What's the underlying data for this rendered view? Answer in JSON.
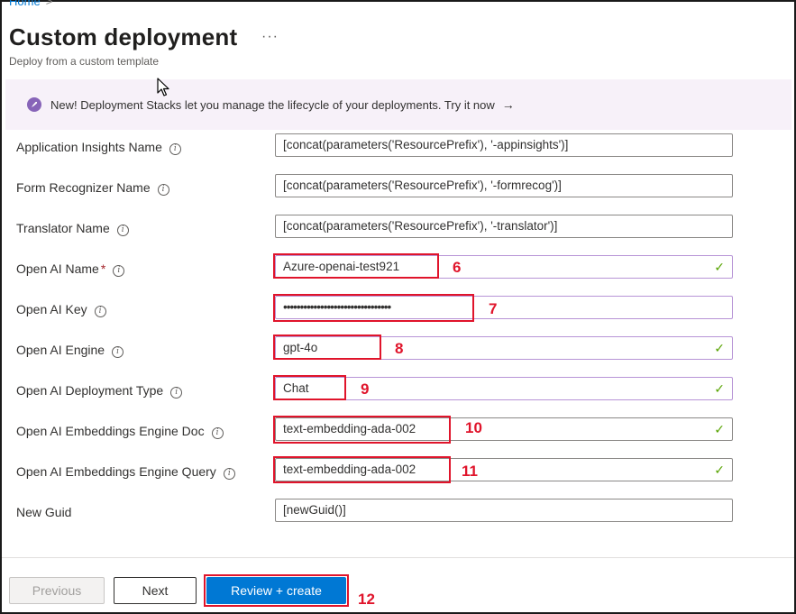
{
  "breadcrumb": {
    "home": "Home",
    "separator": ">"
  },
  "header": {
    "title": "Custom deployment",
    "more": "···",
    "subtitle": "Deploy from a custom template"
  },
  "banner": {
    "text": "New! Deployment Stacks let you manage the lifecycle of your deployments. Try it now",
    "arrow": "→",
    "icon": "rocket-badge-icon",
    "accent": "#8764b8"
  },
  "form": {
    "fields": [
      {
        "label": "Application Insights Name",
        "value": "[concat(parameters('ResourcePrefix'), '-appinsights')]"
      },
      {
        "label": "Form Recognizer Name",
        "value": "[concat(parameters('ResourcePrefix'), '-formrecog')]"
      },
      {
        "label": "Translator Name",
        "value": "[concat(parameters('ResourcePrefix'), '-translator')]"
      },
      {
        "label": "Open AI Name",
        "required": "*",
        "value": "Azure-openai-test921",
        "annotation": "6"
      },
      {
        "label": "Open AI Key",
        "value": "••••••••••••••••••••••••••••••••",
        "annotation": "7"
      },
      {
        "label": "Open AI Engine",
        "value": "gpt-4o",
        "annotation": "8"
      },
      {
        "label": "Open AI Deployment Type",
        "value": "Chat",
        "annotation": "9"
      },
      {
        "label": "Open AI Embeddings Engine Doc",
        "value": "text-embedding-ada-002",
        "annotation": "10"
      },
      {
        "label": "Open AI Embeddings Engine Query",
        "value": "text-embedding-ada-002",
        "annotation": "11"
      },
      {
        "label": "New Guid",
        "value": "[newGuid()]"
      }
    ],
    "info_glyph": "i",
    "check_glyph": "✓"
  },
  "footer": {
    "previous": "Previous",
    "next": "Next",
    "review": "Review + create",
    "review_annotation": "12"
  },
  "colors": {
    "primary": "#0078d4",
    "annotation": "#e0142b",
    "valid_check": "#57a300",
    "valid_border": "#b794d6"
  }
}
